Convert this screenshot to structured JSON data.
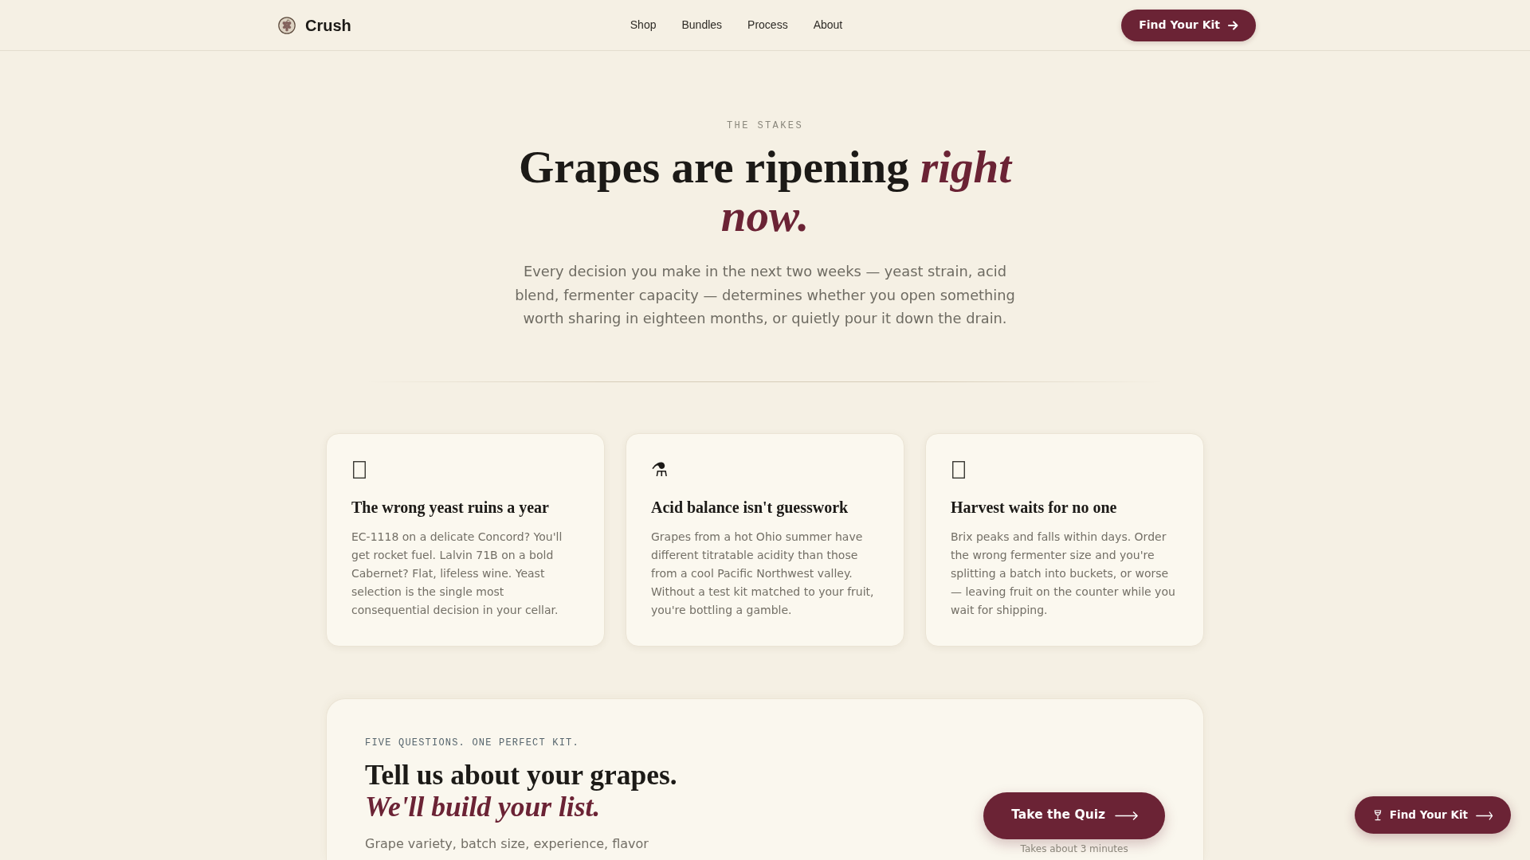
{
  "nav": {
    "brand": "Crush",
    "links": [
      "Shop",
      "Bundles",
      "Process",
      "About"
    ],
    "cta": "Find Your Kit"
  },
  "hero": {
    "eyebrow": "THE STAKES",
    "heading": "Grapes are ripening *right now.*",
    "lead": "Every decision you make in the next two weeks — yeast strain, acid blend, fermenter capacity — determines whether you open something worth sharing in eighteen months, or quietly pour it down the drain."
  },
  "cards": [
    {
      "title": "The wrong yeast ruins a year",
      "body": "EC-1118 on a delicate Concord? You'll get rocket fuel. Lalvin 71B on a bold Cabernet? Flat, lifeless wine. Yeast selection is the single most consequential decision in your cellar."
    },
    {
      "glyph": "⚗",
      "title": "Acid balance isn't guesswork",
      "body": "Grapes from a hot Ohio summer have different titratable acidity than those from a cool Pacific Northwest valley. Without a test kit matched to your fruit, you're bottling a gamble."
    },
    {
      "title": "Harvest waits for no one",
      "body": "Brix peaks and falls within days. Order the wrong fermenter size and you're splitting a batch into buckets, or worse — leaving fruit on the counter while you wait for shipping."
    }
  ],
  "quiz": {
    "eyebrow": "FIVE QUESTIONS. ONE PERFECT KIT.",
    "heading": "Tell us about your grapes. *We'll build your list.*",
    "text": "Grape variety, batch size, experience, flavor",
    "button": "Take the Quiz",
    "note": "Takes about 3 minutes"
  },
  "floating_button": {
    "label": "Find Your Kit"
  }
}
